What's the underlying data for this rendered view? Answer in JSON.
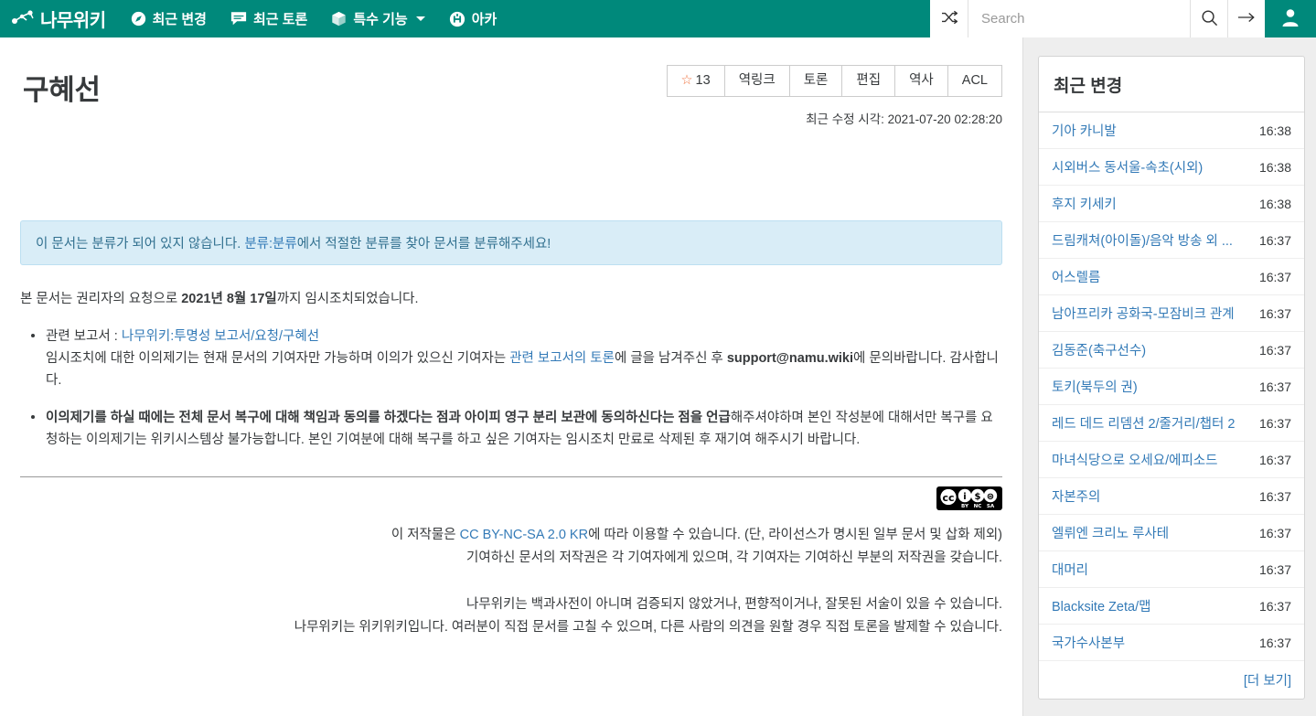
{
  "navbar": {
    "brand": "나무위키",
    "items": [
      {
        "label": "최근 변경",
        "icon": "compass-icon",
        "caret": false
      },
      {
        "label": "최근 토론",
        "icon": "chat-icon",
        "caret": false
      },
      {
        "label": "특수 기능",
        "icon": "cube-icon",
        "caret": true
      },
      {
        "label": "아카",
        "icon": "arca-badge-icon",
        "caret": false
      }
    ],
    "shuffle_icon": "shuffle-icon",
    "search_placeholder": "Search",
    "search_value": "",
    "search_icon": "magnifier-icon",
    "go_icon": "arrow-right-icon",
    "user_icon": "user-avatar-icon",
    "accent_color": "#00897b"
  },
  "article": {
    "title": "구혜선",
    "buttons": [
      {
        "name": "star-count",
        "star": "☆",
        "label": "13"
      },
      {
        "name": "backlink",
        "label": "역링크"
      },
      {
        "name": "discussion",
        "label": "토론"
      },
      {
        "name": "edit",
        "label": "편집"
      },
      {
        "name": "history",
        "label": "역사"
      },
      {
        "name": "acl",
        "label": "ACL"
      }
    ],
    "last_modified": "최근 수정 시각: 2021-07-20 02:28:20",
    "notice": {
      "before": "이 문서는 분류가 되어 있지 않습니다. ",
      "link": "분류:분류",
      "after": "에서 적절한 분류를 찾아 문서를 분류해주세요!"
    },
    "intro": {
      "p1_a": "본 문서는 권리자의 요청으로 ",
      "p1_b": "2021년 8월 17일",
      "p1_c": "까지 임시조치되었습니다."
    },
    "bullets": {
      "b1_label": "관련 보고서 : ",
      "b1_link": "나무위키:투명성 보고서/요청/구혜선",
      "b1_line2_a": "임시조치에 대한 이의제기는 현재 문서의 기여자만 가능하며 이의가 있으신 기여자는 ",
      "b1_line2_link": "관련 보고서의 토론",
      "b1_line2_b": "에 글을 남겨주신 후 ",
      "b1_line2_bold": "support@namu.wiki",
      "b1_line2_c": "에 문의바랍니다. 감사합니다.",
      "b2_bold": "이의제기를 하실 때에는 전체 문서 복구에 대해 책임과 동의를 하겠다는 점과 아이피 영구 분리 보관에 동의하신다는 점을 언급",
      "b2_rest": "해주셔야하며 본인 작성분에 대해서만 복구를 요청하는 이의제기는 위키시스템상 불가능합니다. 본인 기여분에 대해 복구를 하고 싶은 기여자는 임시조치 만료로 삭제된 후 재기여 해주시기 바랍니다."
    }
  },
  "license": {
    "badge_icon": "creative-commons-badge",
    "line1_a": "이 저작물은 ",
    "line1_link": "CC BY-NC-SA 2.0 KR",
    "line1_b": "에 따라 이용할 수 있습니다. (단, 라이선스가 명시된 일부 문서 및 삽화 제외)",
    "line2": "기여하신 문서의 저작권은 각 기여자에게 있으며, 각 기여자는 기여하신 부분의 저작권을 갖습니다.",
    "disclaimer1": "나무위키는 백과사전이 아니며 검증되지 않았거나, 편향적이거나, 잘못된 서술이 있을 수 있습니다.",
    "disclaimer2": "나무위키는 위키위키입니다. 여러분이 직접 문서를 고칠 수 있으며, 다른 사람의 의견을 원할 경우 직접 토론을 발제할 수 있습니다."
  },
  "rail": {
    "card_title": "최근 변경",
    "more_label": "[더 보기]",
    "rows": [
      {
        "name": "기아 카니발",
        "time": "16:38"
      },
      {
        "name": "시외버스 동서울-속초(시외)",
        "time": "16:38"
      },
      {
        "name": "후지 키세키",
        "time": "16:38"
      },
      {
        "name": "드림캐쳐(아이돌)/음악 방송 외 ...",
        "time": "16:37"
      },
      {
        "name": "어스렐름",
        "time": "16:37"
      },
      {
        "name": "남아프리카 공화국-모잠비크 관계",
        "time": "16:37"
      },
      {
        "name": "김동준(축구선수)",
        "time": "16:37"
      },
      {
        "name": "토키(북두의 권)",
        "time": "16:37"
      },
      {
        "name": "레드 데드 리뎀션 2/줄거리/챕터 2",
        "time": "16:37"
      },
      {
        "name": "마녀식당으로 오세요/에피소드",
        "time": "16:37"
      },
      {
        "name": "자본주의",
        "time": "16:37"
      },
      {
        "name": "엘뤼엔 크리노 루사테",
        "time": "16:37"
      },
      {
        "name": "대머리",
        "time": "16:37"
      },
      {
        "name": "Blacksite Zeta/맵",
        "time": "16:37"
      },
      {
        "name": "국가수사본부",
        "time": "16:37"
      }
    ]
  }
}
